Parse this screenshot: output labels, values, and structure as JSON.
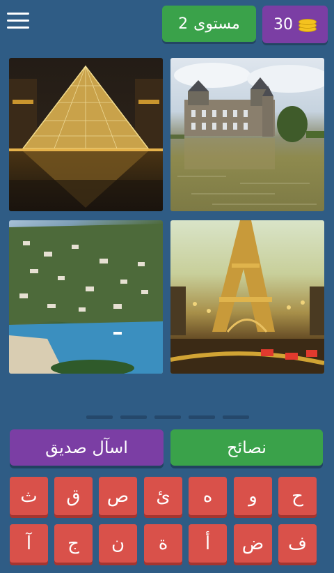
{
  "header": {
    "level_label": "مستوى",
    "level_number": "2",
    "coins": "30"
  },
  "icons": {
    "menu": "hamburger-menu-icon",
    "coins": "coin-stack-icon"
  },
  "answer": {
    "slots": 5
  },
  "buttons": {
    "ask_friend": "اسآل صديق",
    "tips": "نصائح"
  },
  "keyboard": {
    "row1": [
      "ح",
      "و",
      "ه",
      "ئ",
      "ص",
      "ق",
      "ث"
    ],
    "row2": [
      "ف",
      "ض",
      "أ",
      "ة",
      "ن",
      "ج",
      "آ"
    ]
  },
  "colors": {
    "background": "#2f5c85",
    "green": "#3aa24a",
    "purple": "#7b3ea4",
    "key_red": "#d9514a"
  }
}
